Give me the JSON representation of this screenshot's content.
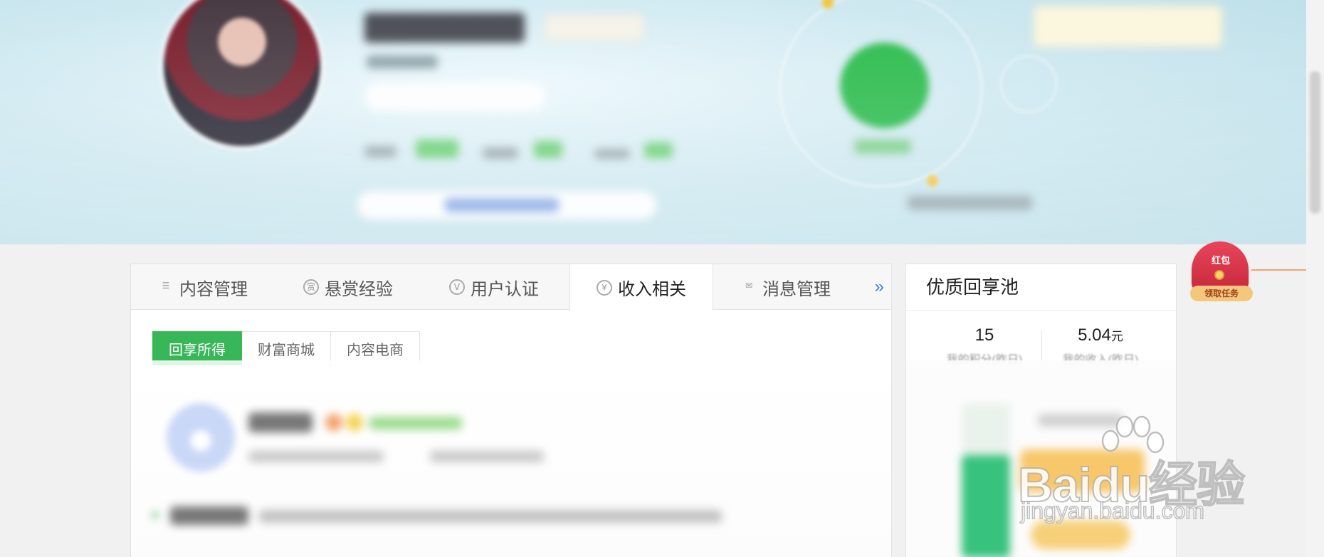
{
  "tabs": [
    {
      "label": "内容管理",
      "icon": "list-icon",
      "active": false
    },
    {
      "label": "悬赏经验",
      "icon": "reward-icon",
      "active": false
    },
    {
      "label": "用户认证",
      "icon": "verify-icon",
      "active": false
    },
    {
      "label": "收入相关",
      "icon": "yen-icon",
      "active": true
    },
    {
      "label": "消息管理",
      "icon": "mail-icon",
      "active": false
    }
  ],
  "tabs_more": "»",
  "subtabs": [
    {
      "label": "回享所得",
      "active": true
    },
    {
      "label": "财富商城",
      "active": false
    },
    {
      "label": "内容电商",
      "active": false
    }
  ],
  "side": {
    "title": "优质回享池",
    "stats": [
      {
        "value": "15",
        "unit": "",
        "label": "我的积分(昨日)"
      },
      {
        "value": "5.04",
        "unit": "元",
        "label": "我的收入(昨日)"
      }
    ]
  },
  "redpacket": {
    "label": "红包",
    "button": "领取任务"
  },
  "watermark": {
    "brand": "Baidu经验",
    "url": "jingyan.baidu.com"
  },
  "colors": {
    "accent_green": "#38b759",
    "link_blue": "#3b7be0",
    "red_packet": "#d6334a"
  }
}
